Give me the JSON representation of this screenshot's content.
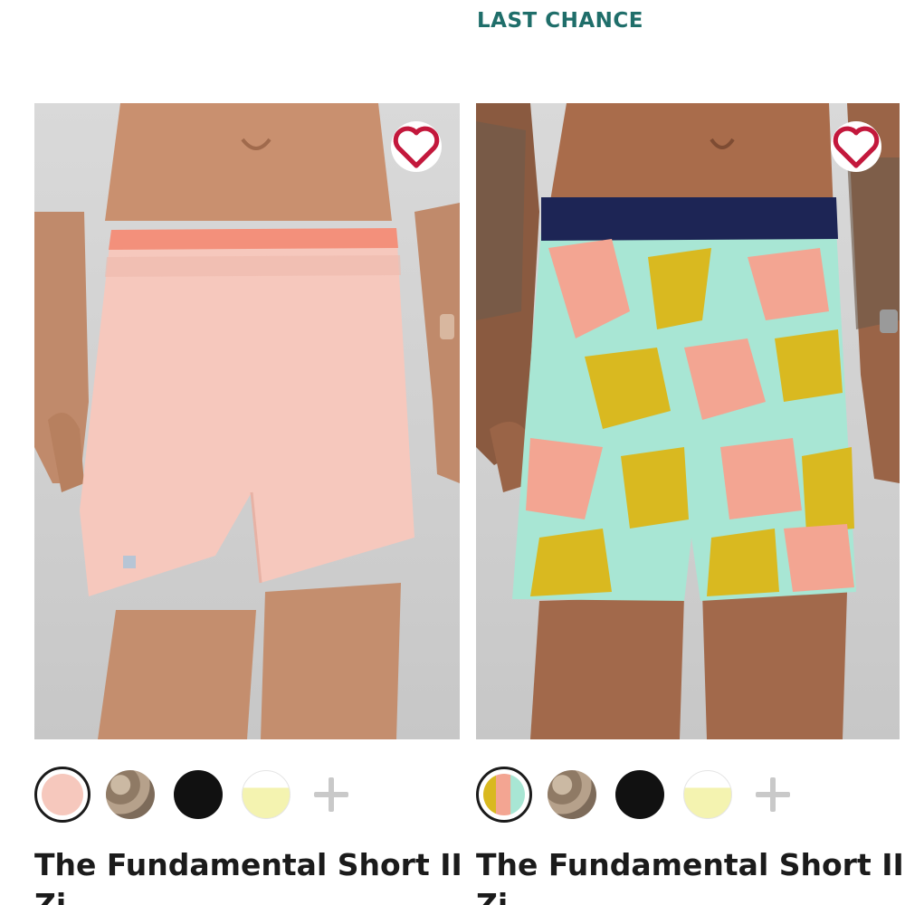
{
  "badge": "LAST CHANCE",
  "products": [
    {
      "name_line1": "The Fundamental Short II",
      "name_line2": "Zi",
      "wishlist_icon": "heart-outline-icon",
      "colors": {
        "waistband": "#f3907b",
        "short": "#f6c8bd",
        "skin": "#c98f6e"
      },
      "swatches": [
        {
          "name": "blush",
          "color": "#f6c8bd",
          "selected": true
        },
        {
          "name": "camo",
          "color": "#a8937d",
          "selected": false
        },
        {
          "name": "black",
          "color": "#111111",
          "selected": false
        },
        {
          "name": "lemon",
          "color": "#f4f3b0",
          "selected": false
        }
      ],
      "more_icon": "plus-icon"
    },
    {
      "name_line1": "The Fundamental Short II",
      "name_line2": "Zi",
      "wishlist_icon": "heart-outline-icon",
      "colors": {
        "waistband": "#1d2555",
        "short": "#a8e6d4",
        "pattern_a": "#f3a592",
        "pattern_b": "#d9b920",
        "skin": "#a86b4a"
      },
      "swatches": [
        {
          "name": "print",
          "color": "#e8c0a8",
          "selected": true
        },
        {
          "name": "camo",
          "color": "#a8937d",
          "selected": false
        },
        {
          "name": "black",
          "color": "#111111",
          "selected": false
        },
        {
          "name": "lemon",
          "color": "#f4f3b0",
          "selected": false
        }
      ],
      "more_icon": "plus-icon"
    }
  ]
}
